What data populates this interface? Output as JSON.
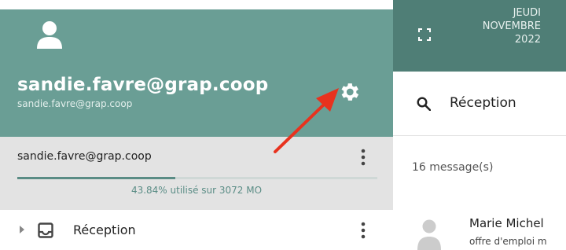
{
  "sidebar": {
    "user_title": "sandie.favre@grap.coop",
    "user_subtitle": "sandie.favre@grap.coop",
    "avatar_icon": "person-icon",
    "settings_icon": "gear-icon",
    "account": {
      "label": "sandie.favre@grap.coop",
      "quota_percent": 43.84,
      "quota_text": "43.84% utilisé sur 3072 MO"
    },
    "folders": [
      {
        "label": "Réception",
        "icon": "inbox-icon"
      }
    ]
  },
  "header": {
    "date_lines": [
      "JEUDI",
      "NOVEMBRE",
      "2022"
    ],
    "fullscreen_icon": "fullscreen-icon"
  },
  "search": {
    "label": "Réception",
    "icon": "search-icon"
  },
  "messages": {
    "count_text": "16 message(s)",
    "items": [
      {
        "sender": "Marie Michel",
        "preview": "offre d'emploi m"
      }
    ]
  },
  "colors": {
    "header_green": "#6a9e95",
    "dark_green": "#4f7e76",
    "quota_fill": "#5a8c85",
    "arrow": "#e8321e"
  }
}
